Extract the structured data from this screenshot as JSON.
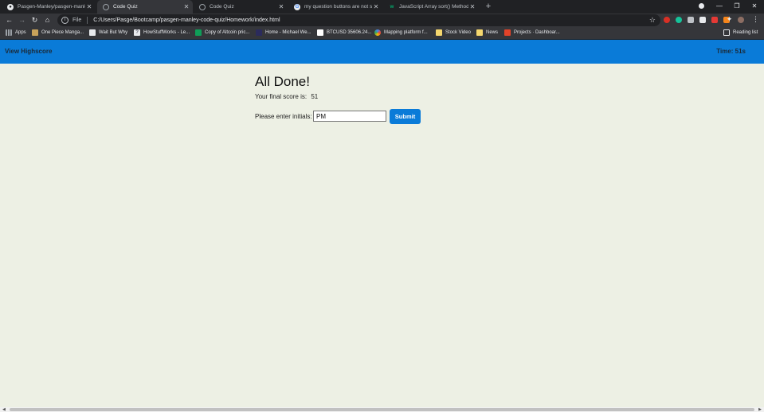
{
  "browser": {
    "tabs": [
      {
        "title": "Pasgen-Manley/pasgen-manley-",
        "favicon": "github-icon"
      },
      {
        "title": "Code Quiz",
        "favicon": "globe-icon",
        "active": true
      },
      {
        "title": "Code Quiz",
        "favicon": "globe-icon"
      },
      {
        "title": "my question buttons are not sto",
        "favicon": "google-icon"
      },
      {
        "title": "JavaScript Array sort() Method",
        "favicon": "w3schools-icon"
      }
    ],
    "new_tab_label": "+",
    "window_controls": {
      "minimize": "—",
      "restore": "❐",
      "close": "✕"
    },
    "address": {
      "scheme": "File",
      "path": "C:/Users/Pasge/Bootcamp/pasgen-manley-code-quiz/Homework/index.html"
    },
    "bookmarks": [
      {
        "label": "Apps",
        "icon": "apps-grid-icon",
        "color": "#9aa0a6"
      },
      {
        "label": "One Piece Manga...",
        "icon": "one-piece-icon",
        "color": "#c8a25a"
      },
      {
        "label": "Wait But Why",
        "icon": "waitbutwhy-icon",
        "color": "#e8eaed"
      },
      {
        "label": "HowStuffWorks - Le...",
        "icon": "howstuffworks-icon",
        "color": "#1a1a2e"
      },
      {
        "label": "Copy of Altcoin pric...",
        "icon": "sheets-icon",
        "color": "#0f9d58"
      },
      {
        "label": "Home - Michael We...",
        "icon": "site-icon",
        "color": "#2b2b5c"
      },
      {
        "label": "BTCUSD 35606.24...",
        "icon": "tradingview-icon",
        "color": "#ffffff"
      },
      {
        "label": "Mapping platform f...",
        "icon": "mapping-icon",
        "color": "#4285f4"
      },
      {
        "label": "Stock Video",
        "icon": "folder-icon",
        "color": "#f5d76e"
      },
      {
        "label": "News",
        "icon": "folder-icon",
        "color": "#f5d76e"
      },
      {
        "label": "Projects · Dashboar...",
        "icon": "gitlab-icon",
        "color": "#e24329"
      }
    ],
    "reading_list": "Reading list"
  },
  "quiz": {
    "header": {
      "highscore_link": "View Highscore",
      "timer": "Time: 51s"
    },
    "title": "All Done!",
    "score_label": "Your final score is:",
    "score_value": "51",
    "initials_label": "Please enter initials:",
    "initials_value": "PM",
    "submit_label": "Submit"
  },
  "colors": {
    "header": "#0a7bd8",
    "page_bg": "#edf0e4",
    "button": "#0a7bd8"
  }
}
